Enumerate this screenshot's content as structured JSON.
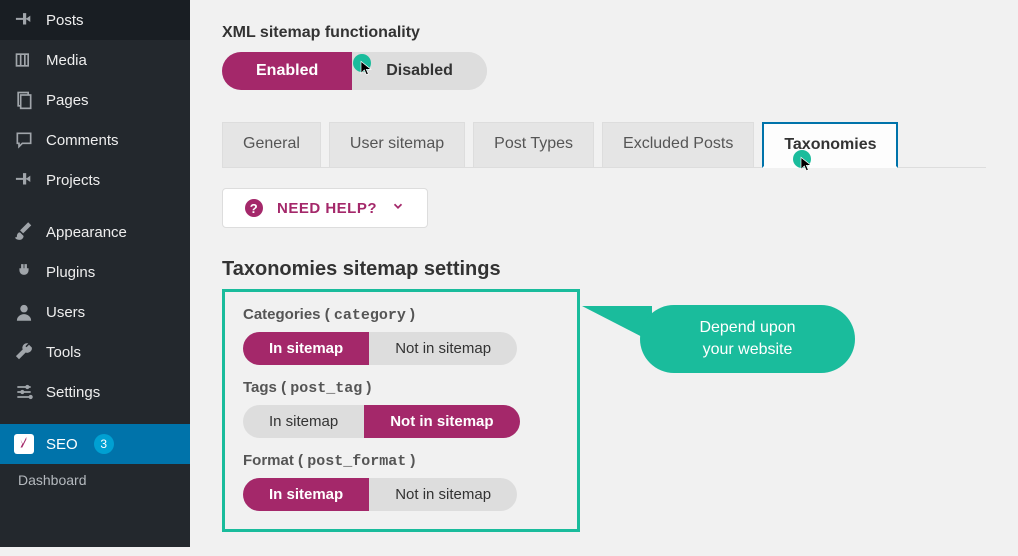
{
  "sidebar": {
    "items": [
      {
        "label": "Posts"
      },
      {
        "label": "Media"
      },
      {
        "label": "Pages"
      },
      {
        "label": "Comments"
      },
      {
        "label": "Projects"
      },
      {
        "label": "Appearance"
      },
      {
        "label": "Plugins"
      },
      {
        "label": "Users"
      },
      {
        "label": "Tools"
      },
      {
        "label": "Settings"
      }
    ],
    "seo": {
      "label": "SEO",
      "badge": "3"
    },
    "sub": {
      "dashboard": "Dashboard"
    }
  },
  "header": {
    "title": "XML sitemap functionality",
    "toggle": {
      "enabled": "Enabled",
      "disabled": "Disabled"
    }
  },
  "tabs": {
    "general": "General",
    "user": "User sitemap",
    "post": "Post Types",
    "excluded": "Excluded Posts",
    "tax": "Taxonomies"
  },
  "help": "NEED HELP?",
  "settings_title": "Taxonomies sitemap settings",
  "tax": {
    "categories": {
      "label": "Categories",
      "slug": "category",
      "in": "In sitemap",
      "out": "Not in sitemap"
    },
    "tags": {
      "label": "Tags",
      "slug": "post_tag",
      "in": "In sitemap",
      "out": "Not in sitemap"
    },
    "format": {
      "label": "Format",
      "slug": "post_format",
      "in": "In sitemap",
      "out": "Not in sitemap"
    }
  },
  "callout": {
    "line1": "Depend upon",
    "line2": "your website"
  }
}
